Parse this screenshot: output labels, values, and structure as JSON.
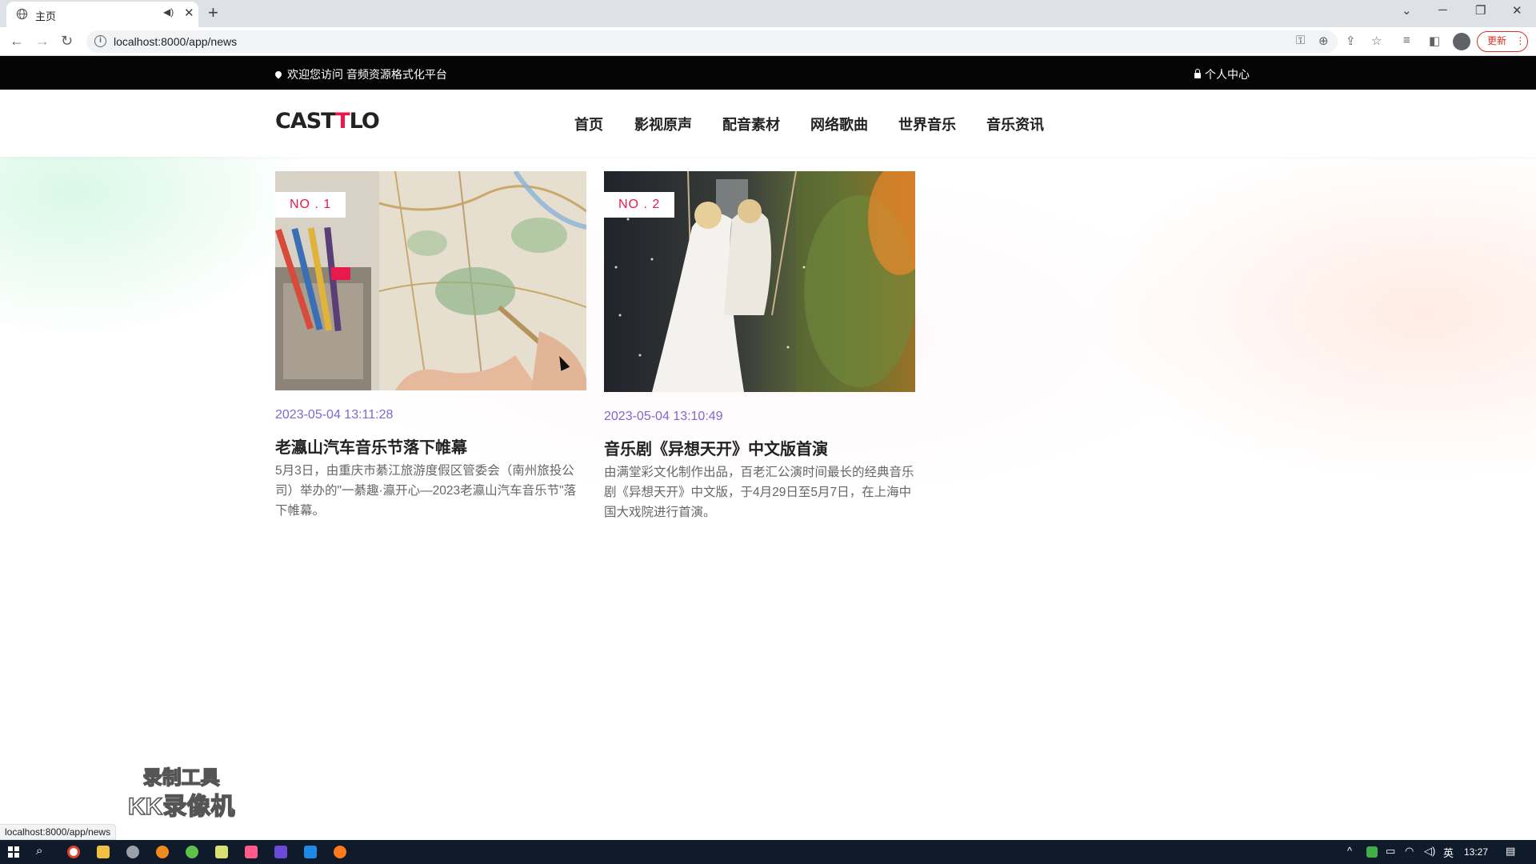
{
  "browser": {
    "tab_title": "主页",
    "url": "localhost:8000/app/news",
    "update_label": "更新",
    "status_url": "localhost:8000/app/news"
  },
  "site": {
    "welcome": "欢迎您访问 音频资源格式化平台",
    "user_center": "个人中心",
    "logo_left": "CAST",
    "logo_mark": "T",
    "logo_right": "LO",
    "nav": [
      "首页",
      "影视原声",
      "配音素材",
      "网络歌曲",
      "世界音乐",
      "音乐资讯"
    ]
  },
  "news": [
    {
      "badge": "NO . 1",
      "date": "2023-05-04 13:11:28",
      "title": "老瀛山汽车音乐节落下帷幕",
      "desc": "5月3日，由重庆市綦江旅游度假区管委会（南州旅投公司）举办的\"一綦趣·瀛开心—2023老瀛山汽车音乐节\"落下帷幕。"
    },
    {
      "badge": "NO . 2",
      "date": "2023-05-04 13:10:49",
      "title": "音乐剧《异想天开》中文版首演",
      "desc": "由满堂彩文化制作出品，百老汇公演时间最长的经典音乐剧《异想天开》中文版，于4月29日至5月7日，在上海中国大戏院进行首演。"
    }
  ],
  "watermark": {
    "line1": "录制工具",
    "line2": "KK录像机"
  },
  "taskbar": {
    "ime": "英",
    "time": "13:27"
  },
  "colors": {
    "accent": "#e8194b",
    "date": "#7a6bd2",
    "topbar": "#050505"
  }
}
